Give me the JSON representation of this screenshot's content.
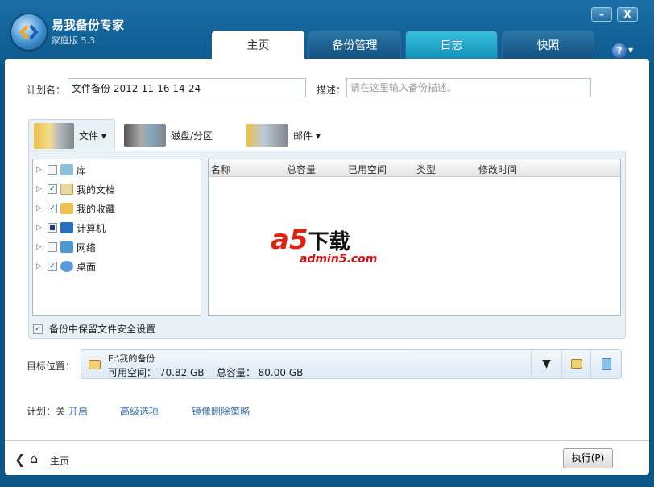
{
  "app": {
    "title": "易我备份专家",
    "version": "家庭版 5.3",
    "minimize": "–",
    "close": "X",
    "help": "?"
  },
  "tabs": [
    {
      "label": "主页"
    },
    {
      "label": "备份管理"
    },
    {
      "label": "日志"
    },
    {
      "label": "快照"
    }
  ],
  "form": {
    "plan_label": "计划名：",
    "plan_value": "文件备份 2012-11-16 14-24",
    "desc_label": "描述：",
    "desc_placeholder": "请在这里输入备份描述。"
  },
  "source_tabs": [
    {
      "label": "文件 ▾"
    },
    {
      "label": "磁盘/分区"
    },
    {
      "label": "邮件 ▾"
    }
  ],
  "tree": [
    {
      "label": "库",
      "checked": "none"
    },
    {
      "label": "我的文档",
      "checked": "full"
    },
    {
      "label": "我的收藏",
      "checked": "full"
    },
    {
      "label": "计算机",
      "checked": "partial"
    },
    {
      "label": "网络",
      "checked": "none"
    },
    {
      "label": "桌面",
      "checked": "full"
    }
  ],
  "list": {
    "columns": [
      "名称",
      "总容量",
      "已用空间",
      "类型",
      "修改时间"
    ]
  },
  "keep_security": {
    "label": "备份中保留文件安全设置",
    "checked": true
  },
  "target": {
    "label": "目标位置：",
    "path": "E:\\我的备份",
    "free_label": "可用空间：",
    "free": "70.82 GB",
    "total_label": "总容量：",
    "total": "80.00 GB"
  },
  "links": {
    "plan_prefix": "计划：关",
    "plan_on": "开启",
    "advanced": "高级选项",
    "mirror": "镜像删除策略"
  },
  "footer": {
    "home": "主页",
    "run": "执行(P)"
  },
  "watermark": {
    "logo": "a5下载",
    "url": "admin5.com"
  },
  "colors": {
    "frame": "#0d5688",
    "link": "#3c6fb0",
    "panel": "#e9f1f6"
  }
}
